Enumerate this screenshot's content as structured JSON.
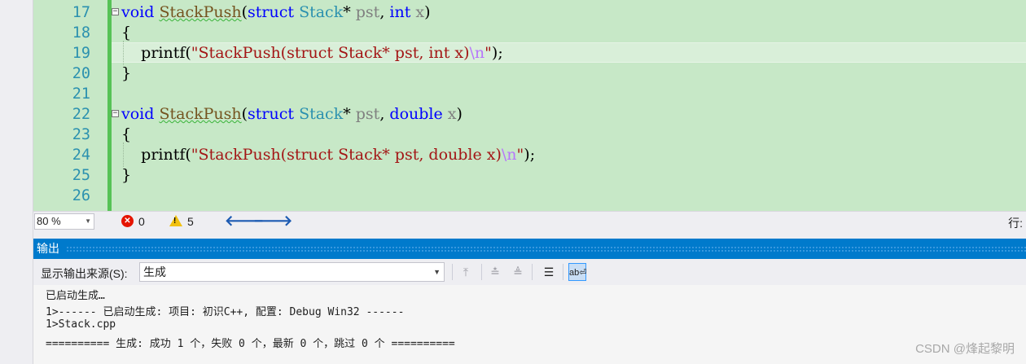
{
  "editor": {
    "lines": [
      {
        "num": "17",
        "tokens": [
          [
            "kw",
            "void"
          ],
          [
            "",
            " "
          ],
          [
            "fn",
            "StackPush"
          ],
          [
            "",
            "("
          ],
          [
            "kw",
            "struct"
          ],
          [
            "",
            " "
          ],
          [
            "ty",
            "Stack"
          ],
          [
            "",
            "* "
          ],
          [
            "pm",
            "pst"
          ],
          [
            "",
            ", "
          ],
          [
            "kw",
            "int"
          ],
          [
            "",
            " "
          ],
          [
            "pm",
            "x"
          ],
          [
            "",
            ")"
          ]
        ],
        "collapse": true
      },
      {
        "num": "18",
        "tokens": [
          [
            "",
            "{"
          ]
        ]
      },
      {
        "num": "19",
        "tokens": [
          [
            "",
            "    printf("
          ],
          [
            "str",
            "\"StackPush(struct Stack* pst, int x)"
          ],
          [
            "esc",
            "\\n"
          ],
          [
            "str",
            "\""
          ],
          [
            "",
            ");"
          ]
        ]
      },
      {
        "num": "20",
        "tokens": [
          [
            "",
            "}"
          ]
        ]
      },
      {
        "num": "21",
        "tokens": []
      },
      {
        "num": "22",
        "tokens": [
          [
            "kw",
            "void"
          ],
          [
            "",
            " "
          ],
          [
            "fn",
            "StackPush"
          ],
          [
            "",
            "("
          ],
          [
            "kw",
            "struct"
          ],
          [
            "",
            " "
          ],
          [
            "ty",
            "Stack"
          ],
          [
            "",
            "* "
          ],
          [
            "pm",
            "pst"
          ],
          [
            "",
            ", "
          ],
          [
            "kw",
            "double"
          ],
          [
            "",
            " "
          ],
          [
            "pm",
            "x"
          ],
          [
            "",
            ")"
          ]
        ],
        "collapse": true
      },
      {
        "num": "23",
        "tokens": [
          [
            "",
            "{"
          ]
        ]
      },
      {
        "num": "24",
        "tokens": [
          [
            "",
            "    printf("
          ],
          [
            "str",
            "\"StackPush(struct Stack* pst, double x)"
          ],
          [
            "esc",
            "\\n"
          ],
          [
            "str",
            "\""
          ],
          [
            "",
            ");"
          ]
        ]
      },
      {
        "num": "25",
        "tokens": [
          [
            "",
            "}"
          ]
        ]
      },
      {
        "num": "26",
        "tokens": []
      }
    ]
  },
  "statusbar": {
    "zoom": "80 %",
    "errors": "0",
    "warnings": "5",
    "row_label": "行:"
  },
  "output": {
    "title": "输出",
    "source_label": "显示输出来源(S):",
    "source_value": "生成",
    "lines": [
      "已启动生成…",
      "1>------ 已启动生成: 项目: 初识C++, 配置: Debug Win32 ------",
      "1>Stack.cpp",
      "========== 生成: 成功 1 个，失败 0 个，最新 0 个，跳过 0 个 =========="
    ]
  },
  "watermark": "CSDN @烽起黎明",
  "icons": {
    "error": "error-icon",
    "warning": "warning-icon",
    "back": "arrow-left-icon",
    "forward": "arrow-right-icon",
    "active_tool": "word-wrap-icon"
  }
}
